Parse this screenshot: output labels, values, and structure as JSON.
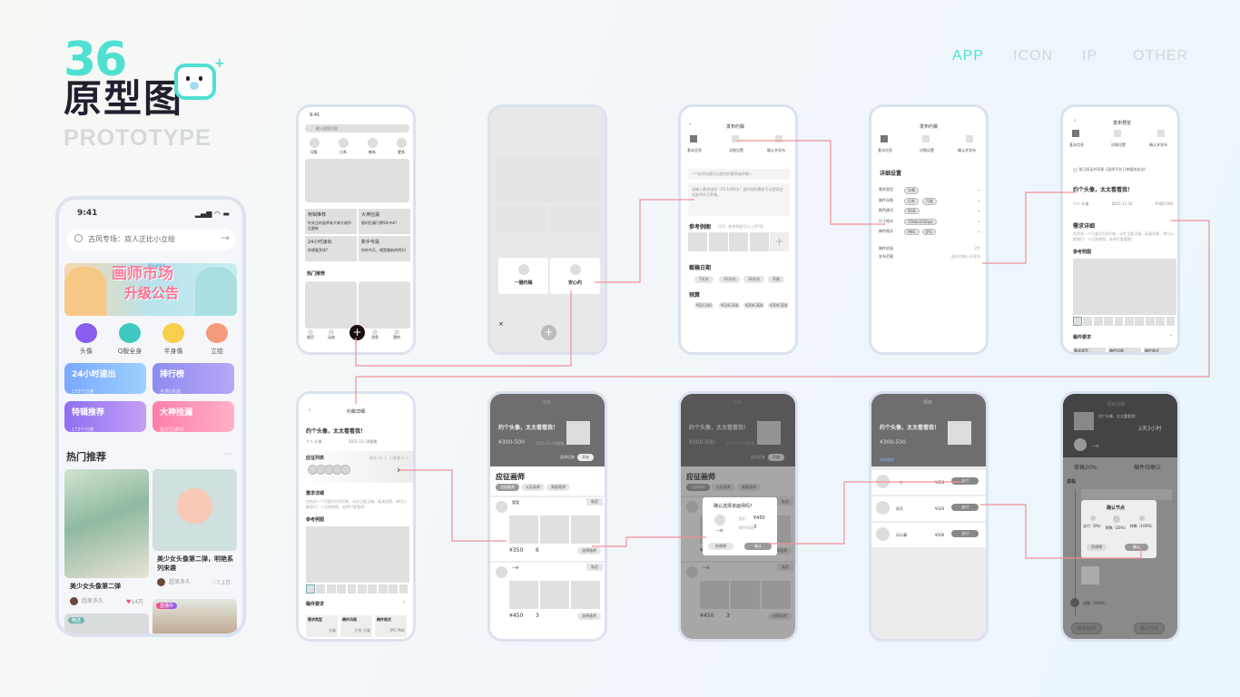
{
  "brand": {
    "number": "36",
    "title": "原型图",
    "subtitle": "PROTOTYPE"
  },
  "nav": [
    {
      "label": "APP",
      "active": true
    },
    {
      "label": "ICON"
    },
    {
      "label": "IP"
    },
    {
      "label": "OTHER"
    }
  ],
  "colors": {
    "accent": "#4fe0d2",
    "connector": "#f0909a",
    "dark": "#221f2e"
  },
  "main_phone": {
    "time": "9:41",
    "signal": "▂▄▆ ◠ ▬",
    "search_placeholder": "古风专场：双人正比小立绘",
    "banner": {
      "logo": "huaya",
      "title": "画师市场",
      "subtitle": "升级公告"
    },
    "categories": [
      "头像",
      "Q版全身",
      "半身像",
      "立绘"
    ],
    "cards": [
      {
        "title": "24小时速出",
        "sub": "173个分类"
      },
      {
        "title": "排行榜",
        "sub": "全场5折起"
      },
      {
        "title": "特辑推荐",
        "sub": "173个分类"
      },
      {
        "title": "大神捡漏",
        "sub": "首次立减50"
      }
    ],
    "section": "热门推荐",
    "more": "···",
    "posts": [
      {
        "title": "美少女头像第二弹",
        "author": "超呆多久",
        "likes": "14万"
      },
      {
        "title": "美少女头像第二弹，明艳系列来袭",
        "author": "超呆多久",
        "likes": "7.1万"
      }
    ],
    "badges": [
      "精选",
      "直播中"
    ]
  },
  "wf_home": {
    "time": "9:41",
    "search": "输入搜索内容",
    "categories": [
      "Q版",
      "日系",
      "韩系",
      "更多"
    ],
    "cards": [
      {
        "title": "特辑推荐",
        "sub": "你关注的画师有大神大佬作品更新"
      },
      {
        "title": "大神捡漏",
        "sub": "限时捡漏只需50rmb?"
      },
      {
        "title": "24小时速出",
        "sub": "你想要多快?"
      },
      {
        "title": "新手专属",
        "sub": "你的今天，就是最新的明天!"
      }
    ],
    "section": "热门推荐",
    "tabs": [
      "首页",
      "动态",
      "消息",
      "我的"
    ]
  },
  "wf_popup": {
    "options": [
      "一键约稿",
      "安心约"
    ],
    "close": "×"
  },
  "wf_publish": {
    "title": "发布约稿",
    "steps": [
      "基本信息",
      "详细设置",
      "确认并发布"
    ],
    "title_placeholder": "一个好的标题可以更快招募到画师哦~",
    "desc_placeholder": "请输入需求描述（10-1000字）越详细的需求可以提高合适画师的几率哦。",
    "ref": "参考例图",
    "ref_hint": "（4/5）参考例图可以上传5张",
    "deadline": "截稿日期",
    "deadline_opts": [
      "7天内",
      "15天内",
      "30天内",
      "不限"
    ],
    "budget": "预算",
    "budget_opts": [
      "¥50-100",
      "¥100-200",
      "¥200-300",
      "¥300-500"
    ]
  },
  "wf_detail": {
    "title": "发布约稿",
    "steps": [
      "基本信息",
      "详细设置",
      "确认并发布"
    ],
    "heading": "详细设置",
    "rows": [
      {
        "label": "需求类型",
        "tags": [
          "头像"
        ]
      },
      {
        "label": "稿件风格",
        "tags": [
          "日系",
          "可爱"
        ]
      },
      {
        "label": "颜色模式",
        "tags": [
          "RGB"
        ]
      },
      {
        "label": "尺寸格式",
        "tags": [
          "1560x1020px"
        ]
      },
      {
        "label": "稿件格式",
        "tags": [
          "PNG",
          "JPG"
        ]
      }
    ],
    "extra": [
      {
        "label": "稿件阶段",
        "value": "2步"
      },
      {
        "label": "发布范围",
        "value": "面向约稿公开发布"
      }
    ]
  },
  "wf_preview": {
    "title": "发布预览",
    "steps": [
      "基本信息",
      "详细设置",
      "确认并发布"
    ],
    "agreement": "我已阅读并同意《画师平台订单服务协议》",
    "heading": "约个头像，太太看看我！",
    "meta": [
      "个人-头像",
      "2021-11-30",
      "¥300-500"
    ],
    "need": "需求详细",
    "need_text": "在找求一个可爱Q头的形象，动作主题正确，高清发图，带可以跟我们！人设和例图，老师们看看哦！",
    "ref": "参考例图",
    "req": "稿件要求",
    "req_items": [
      "需求类型",
      "稿件风格",
      "稿件格式"
    ]
  },
  "wf_order": {
    "title": "约稿详细",
    "heading": "约个头像，太太看看我！",
    "meta": [
      "个人-头像",
      "2021-11-30截稿"
    ],
    "applicants": "应征列表",
    "counts": [
      "报名 10 人",
      "已查看 5 人"
    ],
    "need": "需求详细",
    "need_text": "在找求一个可爱Q头的形象，动作主题正确，高清发图，带可以跟我们！人设和例图，老师们看看哦！",
    "ref": "参考例图",
    "req": "稿件要求",
    "req_items": [
      {
        "label": "需求类型",
        "value": "头像"
      },
      {
        "label": "稿件风格",
        "value": "日系 可爱"
      },
      {
        "label": "稿件格式",
        "value": "JPG PNG"
      }
    ]
  },
  "wf_project": {
    "title": "项目",
    "heading": "约个头像，太太看看我！",
    "price": "¥300-500",
    "date": "2021-11-30截稿",
    "toggle_label": "画师征集",
    "toggle": "开启",
    "section": "应征画师",
    "filters": [
      "全部画师",
      "认证画师",
      "高星画师"
    ],
    "artists": [
      {
        "name": "管管",
        "price": "¥350",
        "count": "6"
      },
      {
        "name": "一叶",
        "price": "¥450",
        "count": "3"
      }
    ],
    "select": "选择画师",
    "tag": "私信"
  },
  "wf_confirm": {
    "title": "项目",
    "question": "确认选择该画师吗?",
    "name": "一叶",
    "price_label": "报价",
    "price": "¥450",
    "count_label": "稿件阶段",
    "count": "3",
    "buttons": [
      "再想想",
      "确认"
    ]
  },
  "wf_pay": {
    "title": "项目",
    "heading": "约个头像，太太看看我！",
    "price": "¥300-500",
    "link": "选择画师",
    "artists": [
      {
        "name": "一叶",
        "price": "¥450"
      },
      {
        "name": "凤凡",
        "price": "¥320"
      },
      {
        "name": "乐乐事",
        "price": "¥500"
      }
    ],
    "pay": "支付"
  },
  "wf_progress": {
    "title": "项目详细",
    "heading": "约个头像，太太看看我！",
    "countdown": "2天3小时",
    "artist": "一叶",
    "progress": "草稿20%",
    "status": "稿件待确认",
    "section": "进程",
    "dialog_title": "确认节点",
    "nodes": [
      "支付（0%）",
      "草稿（20%）",
      "终稿（100%）"
    ],
    "buttons": [
      "再想想",
      "确认"
    ],
    "final": "成图（100%）",
    "footer": [
      "联系画师",
      "确认节点"
    ]
  }
}
